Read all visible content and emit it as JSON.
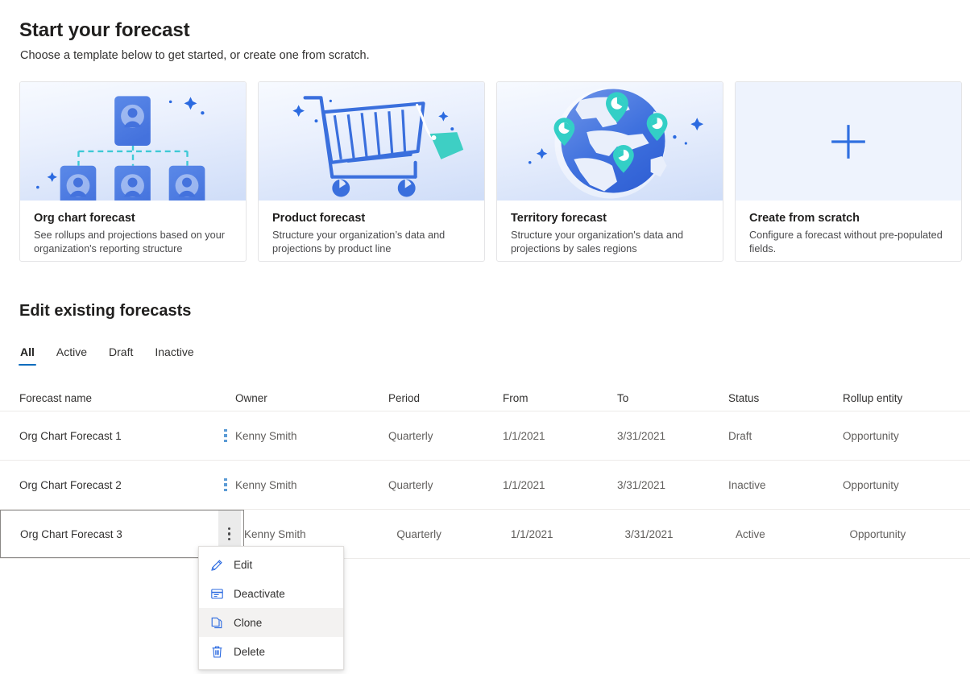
{
  "header": {
    "title": "Start your forecast",
    "subtitle": "Choose a template below to get started, or create one from scratch."
  },
  "templates": [
    {
      "id": "org-chart-forecast",
      "art": "org-chart-illustration",
      "title": "Org chart forecast",
      "desc": "See rollups and projections based on your organization's reporting structure"
    },
    {
      "id": "product-forecast",
      "art": "shopping-cart-illustration",
      "title": "Product forecast",
      "desc": "Structure your organization’s data and projections by product line"
    },
    {
      "id": "territory-forecast",
      "art": "globe-pins-illustration",
      "title": "Territory forecast",
      "desc": "Structure your organization's data and projections by sales regions"
    },
    {
      "id": "create-from-scratch",
      "art": "plus-icon",
      "title": "Create from scratch",
      "desc": "Configure a forecast without pre-populated fields."
    }
  ],
  "existing": {
    "section_title": "Edit existing forecasts",
    "tabs": [
      {
        "label": "All",
        "active": true
      },
      {
        "label": "Active",
        "active": false
      },
      {
        "label": "Draft",
        "active": false
      },
      {
        "label": "Inactive",
        "active": false
      }
    ],
    "columns": [
      "Forecast name",
      "Owner",
      "Period",
      "From",
      "To",
      "Status",
      "Rollup entity"
    ],
    "rows": [
      {
        "name": "Org Chart Forecast 1",
        "owner": "Kenny Smith",
        "period": "Quarterly",
        "from": "1/1/2021",
        "to": "3/31/2021",
        "status": "Draft",
        "rollup": "Opportunity"
      },
      {
        "name": "Org Chart Forecast 2",
        "owner": "Kenny Smith",
        "period": "Quarterly",
        "from": "1/1/2021",
        "to": "3/31/2021",
        "status": "Inactive",
        "rollup": "Opportunity"
      },
      {
        "name": "Org Chart Forecast 3",
        "owner": "Kenny Smith",
        "period": "Quarterly",
        "from": "1/1/2021",
        "to": "3/31/2021",
        "status": "Active",
        "rollup": "Opportunity"
      }
    ]
  },
  "context_menu": {
    "items": [
      {
        "label": "Edit",
        "icon": "pencil-icon",
        "hover": false
      },
      {
        "label": "Deactivate",
        "icon": "deactivate-icon",
        "hover": false
      },
      {
        "label": "Clone",
        "icon": "copy-icon",
        "hover": true
      },
      {
        "label": "Delete",
        "icon": "trash-icon",
        "hover": false
      }
    ]
  },
  "colors": {
    "accent_blue": "#0f6cbd",
    "illustration_blue": "#4a7ae0",
    "illustration_teal": "#3ed0c8",
    "text_primary": "#201f1e",
    "text_secondary": "#605e5c",
    "row_border": "#edebe9"
  }
}
